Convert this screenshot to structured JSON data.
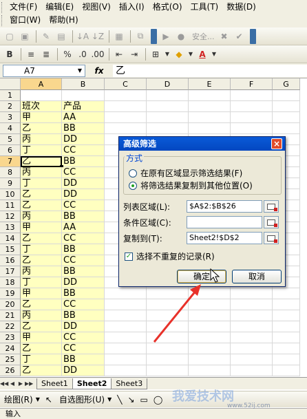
{
  "menubar": {
    "row1": [
      "文件(F)",
      "编辑(E)",
      "视图(V)",
      "插入(I)",
      "格式(O)",
      "工具(T)",
      "数据(D)"
    ],
    "row2": [
      "窗口(W)",
      "帮助(H)"
    ]
  },
  "toolbar": {
    "security_label": "安全...",
    "arial_hint": "B"
  },
  "formula_bar": {
    "cell_ref": "A7",
    "fx_label": "fx",
    "content": "乙"
  },
  "grid": {
    "columns": [
      "A",
      "B",
      "C",
      "D",
      "E",
      "F",
      "G"
    ],
    "rows": [
      {
        "num": "1",
        "a": "",
        "b": ""
      },
      {
        "num": "2",
        "a": "班次",
        "b": "产品"
      },
      {
        "num": "3",
        "a": "甲",
        "b": "AA"
      },
      {
        "num": "4",
        "a": "乙",
        "b": "BB"
      },
      {
        "num": "5",
        "a": "丙",
        "b": "DD"
      },
      {
        "num": "6",
        "a": "丁",
        "b": "CC"
      },
      {
        "num": "7",
        "a": "乙",
        "b": "BB"
      },
      {
        "num": "8",
        "a": "丙",
        "b": "CC"
      },
      {
        "num": "9",
        "a": "丁",
        "b": "DD"
      },
      {
        "num": "10",
        "a": "乙",
        "b": "DD"
      },
      {
        "num": "11",
        "a": "乙",
        "b": "CC"
      },
      {
        "num": "12",
        "a": "丙",
        "b": "BB"
      },
      {
        "num": "13",
        "a": "甲",
        "b": "AA"
      },
      {
        "num": "14",
        "a": "乙",
        "b": "CC"
      },
      {
        "num": "15",
        "a": "丁",
        "b": "BB"
      },
      {
        "num": "16",
        "a": "乙",
        "b": "CC"
      },
      {
        "num": "17",
        "a": "丙",
        "b": "BB"
      },
      {
        "num": "18",
        "a": "丁",
        "b": "DD"
      },
      {
        "num": "19",
        "a": "甲",
        "b": "BB"
      },
      {
        "num": "20",
        "a": "乙",
        "b": "CC"
      },
      {
        "num": "21",
        "a": "丙",
        "b": "BB"
      },
      {
        "num": "22",
        "a": "乙",
        "b": "DD"
      },
      {
        "num": "23",
        "a": "甲",
        "b": "CC"
      },
      {
        "num": "24",
        "a": "乙",
        "b": "CC"
      },
      {
        "num": "25",
        "a": "丁",
        "b": "BB"
      },
      {
        "num": "26",
        "a": "乙",
        "b": "DD"
      }
    ]
  },
  "sheet_tabs": [
    "Sheet1",
    "Sheet2",
    "Sheet3"
  ],
  "active_sheet": "Sheet2",
  "drawbar": {
    "draw_label": "绘图(R)",
    "autoshape_label": "自选图形(U)"
  },
  "status": "输入",
  "dialog": {
    "title": "高级筛选",
    "close_glyph": "×",
    "group_label": "方式",
    "option1": "在原有区域显示筛选结果(F)",
    "option2": "将筛选结果复制到其他位置(O)",
    "selected_option": 2,
    "list_range_label": "列表区域(L):",
    "list_range_value": "$A$2:$B$26",
    "criteria_range_label": "条件区域(C):",
    "criteria_range_value": "",
    "copy_to_label": "复制到(T):",
    "copy_to_value": "Sheet2!$D$2",
    "unique_label": "选择不重复的记录(R)",
    "unique_checked": true,
    "ok_label": "确定",
    "cancel_label": "取消"
  },
  "watermark": {
    "text": "我爱技术网",
    "sub": "www.52ij.com"
  },
  "colors": {
    "highlight": "#ffffc0",
    "title_bar": "#0a5ad8",
    "arrow": "#e8312a"
  }
}
